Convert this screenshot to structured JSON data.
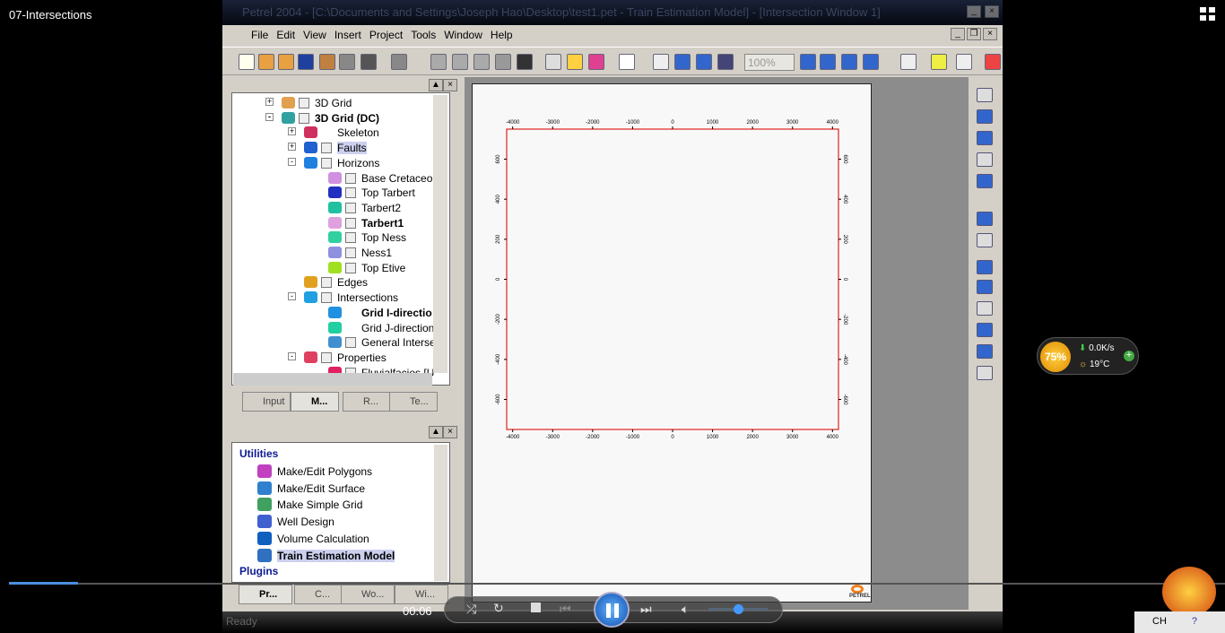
{
  "overlay": {
    "video_title": "07-Intersections",
    "time": "00:06",
    "progress_percent": 5.7,
    "volume_percent": 45
  },
  "app": {
    "title": "Petrel 2004 - [C:\\Documents and Settings\\Joseph Hao\\Desktop\\test1.pet - Train Estimation Model] - [Intersection Window 1]",
    "menu": [
      "File",
      "Edit",
      "View",
      "Insert",
      "Project",
      "Tools",
      "Window",
      "Help"
    ],
    "zoom_value": "100%",
    "status": "Ready"
  },
  "tree": [
    {
      "label": "3D Grid",
      "indent": 0,
      "exp": "+",
      "icon": "#e0a050",
      "cb": true
    },
    {
      "label": "3D Grid (DC)",
      "indent": 0,
      "exp": "-",
      "icon": "#30a0a0",
      "cb": true,
      "bold": true
    },
    {
      "label": "Skeleton",
      "indent": 1,
      "exp": "+",
      "icon": "#d03060",
      "cb": false
    },
    {
      "label": "Faults",
      "indent": 1,
      "exp": "+",
      "icon": "#2060d0",
      "cb": true,
      "sel": true
    },
    {
      "label": "Horizons",
      "indent": 1,
      "exp": "-",
      "icon": "#2080e0",
      "cb": true
    },
    {
      "label": "Base Cretaceou",
      "indent": 2,
      "icon": "#d090e0",
      "cb": true
    },
    {
      "label": "Top Tarbert",
      "indent": 2,
      "icon": "#2030c0",
      "cb": true
    },
    {
      "label": "Tarbert2",
      "indent": 2,
      "icon": "#20c0a0",
      "cb": true
    },
    {
      "label": "Tarbert1",
      "indent": 2,
      "icon": "#e0a0e0",
      "cb": true,
      "bold": true
    },
    {
      "label": "Top Ness",
      "indent": 2,
      "icon": "#30d0a0",
      "cb": true
    },
    {
      "label": "Ness1",
      "indent": 2,
      "icon": "#9090e0",
      "cb": true
    },
    {
      "label": "Top Etive",
      "indent": 2,
      "icon": "#a0e020",
      "cb": true
    },
    {
      "label": "Edges",
      "indent": 1,
      "icon": "#e0a020",
      "cb": true
    },
    {
      "label": "Intersections",
      "indent": 1,
      "exp": "-",
      "icon": "#20a0e0",
      "cb": true
    },
    {
      "label": "Grid I-directio",
      "indent": 2,
      "icon": "#2090e0",
      "cb": false,
      "bold": true
    },
    {
      "label": "Grid J-direction",
      "indent": 2,
      "icon": "#20d0a0",
      "cb": false
    },
    {
      "label": "General Interse",
      "indent": 2,
      "icon": "#4090d0",
      "cb": true
    },
    {
      "label": "Properties",
      "indent": 1,
      "exp": "-",
      "icon": "#e04060",
      "cb": true
    },
    {
      "label": "Fluvialfacies [U",
      "indent": 2,
      "icon": "#e02060",
      "cb": true
    }
  ],
  "tree_tabs": [
    "Input",
    "M...",
    "R...",
    "Te..."
  ],
  "processes": {
    "utilities_header": "Utilities",
    "items": [
      {
        "label": "Make/Edit Polygons",
        "icon": "#c040c0"
      },
      {
        "label": "Make/Edit Surface",
        "icon": "#3080d0"
      },
      {
        "label": "Make Simple Grid",
        "icon": "#40a060"
      },
      {
        "label": "Well Design",
        "icon": "#4060d0"
      },
      {
        "label": "Volume Calculation",
        "icon": "#1060c0"
      },
      {
        "label": "Train Estimation Model",
        "icon": "#3070c0",
        "bold": true
      }
    ],
    "plugins_header": "Plugins",
    "tabs": [
      "Pr...",
      "C...",
      "Wo...",
      "Wi..."
    ]
  },
  "chart_data": {
    "type": "scatter",
    "x_ticks": [
      -4000,
      -3000,
      -2000,
      -1000,
      0,
      1000,
      2000,
      3000,
      4000
    ],
    "y_ticks": [
      600,
      400,
      200,
      0,
      -200,
      -400,
      -600
    ],
    "xlim": [
      -4150,
      4150
    ],
    "ylim": [
      -750,
      750
    ],
    "frame_color": "#e02020",
    "grid": false,
    "series": []
  },
  "widget": {
    "percent": "75%",
    "net": "0.0K/s",
    "temp": "19°C"
  },
  "tray": {
    "lang": "CH"
  },
  "logo_text": "PETREL"
}
